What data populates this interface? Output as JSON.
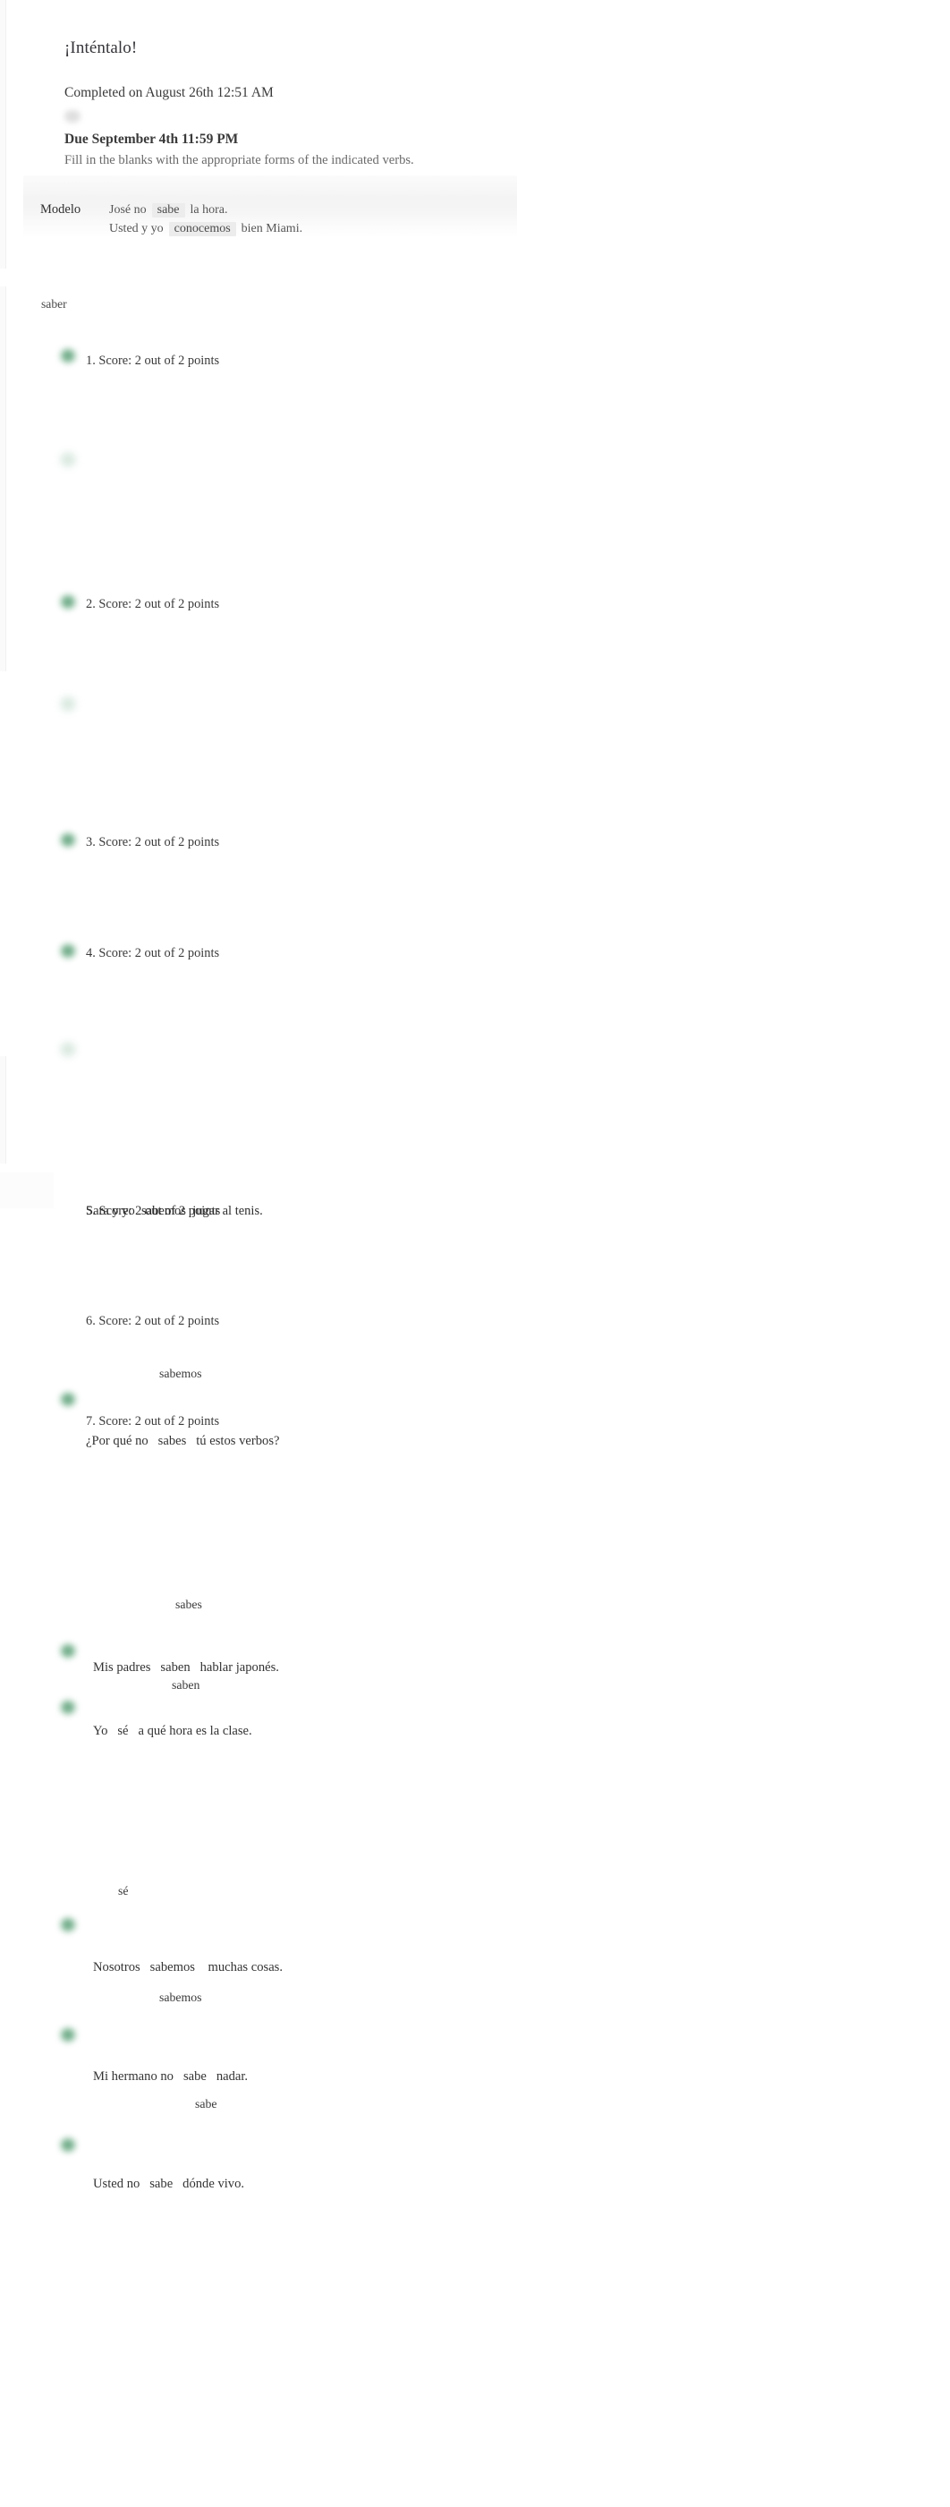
{
  "header": {
    "title": "¡Inténtalo!",
    "completed": "Completed on August 26th 12:51 AM",
    "due": "Due September 4th 11:59 PM",
    "instructions": "Fill in the blanks with the appropriate forms of the indicated verbs."
  },
  "modelo": {
    "label": "Modelo",
    "line1_before": "José no",
    "line1_answer": "sabe",
    "line1_after": "la hora.",
    "line2_before": "Usted y yo",
    "line2_answer": "conocemos",
    "line2_after": "bien Miami."
  },
  "verb_heading": "saber",
  "items": [
    {
      "n": "1",
      "score": "1. Score: 2 out of 2 points"
    },
    {
      "n": "2",
      "score": "2. Score: 2 out of 2 points"
    },
    {
      "n": "3",
      "score": "3. Score: 2 out of 2 points"
    },
    {
      "n": "4",
      "score": "4. Score: 2 out of 2 points"
    },
    {
      "n": "5",
      "score": "5. Score: 2 out of 2 points"
    },
    {
      "n": "6",
      "score": "6. Score: 2 out of 2 points"
    },
    {
      "n": "7",
      "score": "7. Score: 2 out of 2 points"
    }
  ],
  "overlap_row": {
    "score_text": "5. Score: 2 out of 2 points",
    "sentence_before": "Sara y yo",
    "sentence_answer": "sabemos",
    "sentence_after": "jugar al tenis."
  },
  "answers": {
    "a1": "sabemos",
    "a2": "sabes",
    "a3": "saben",
    "a4": "sé",
    "a5": "sabemos",
    "a6": "sabe"
  },
  "sentences": [
    {
      "id": "s7",
      "before": "¿Por qué no",
      "answer": "sabes",
      "after": "tú estos verbos?"
    },
    {
      "id": "s8",
      "before": "Mis padres",
      "answer": "saben",
      "after": "hablar japonés."
    },
    {
      "id": "s9",
      "before": "Yo",
      "answer": "sé",
      "after": "a qué hora es la clase."
    },
    {
      "id": "s10",
      "before": "Nosotros",
      "answer": "sabemos",
      "after": "muchas cosas."
    },
    {
      "id": "s11",
      "before": "Mi hermano no",
      "answer": "sabe",
      "after": "nadar."
    },
    {
      "id": "s12",
      "before": "Usted no",
      "answer": "sabe",
      "after": "dónde vivo."
    }
  ],
  "colors": {
    "correct_green": "#3d8a5e",
    "text": "#3b3b3b",
    "muted": "#6a6a6a",
    "panel_bg": "#f4f4f4"
  }
}
